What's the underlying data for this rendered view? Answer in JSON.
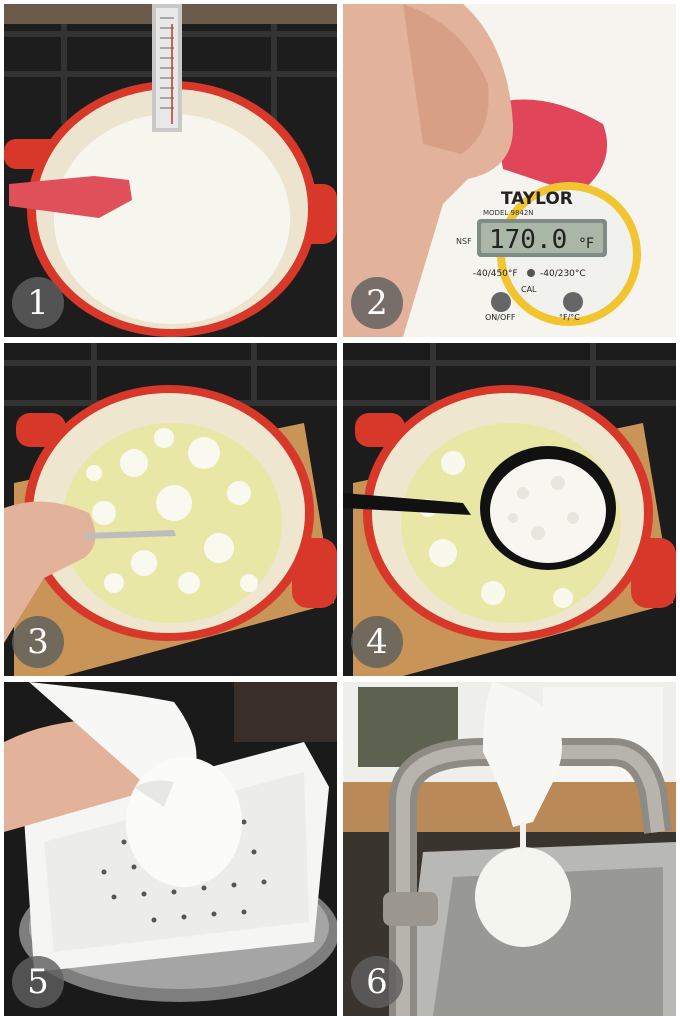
{
  "steps": [
    {
      "number": "1"
    },
    {
      "number": "2"
    },
    {
      "number": "3"
    },
    {
      "number": "4"
    },
    {
      "number": "5"
    },
    {
      "number": "6"
    }
  ],
  "thermometer": {
    "brand": "TAYLOR",
    "model": "MODEL      9842N",
    "reading": "170.0",
    "unit": "°F",
    "nsf": "NSF",
    "range_f": "-40/450°F",
    "range_c": "-40/230°C",
    "cal": "CAL",
    "on_off": "ON/OFF",
    "f_c": "°F/°C"
  },
  "colors": {
    "pot_red": "#d8382a",
    "milk": "#f6f4ea",
    "whey": "#e6e6a0",
    "stove": "#1e1e1e",
    "board": "#c9955a",
    "badge": "#5f5f5f"
  }
}
